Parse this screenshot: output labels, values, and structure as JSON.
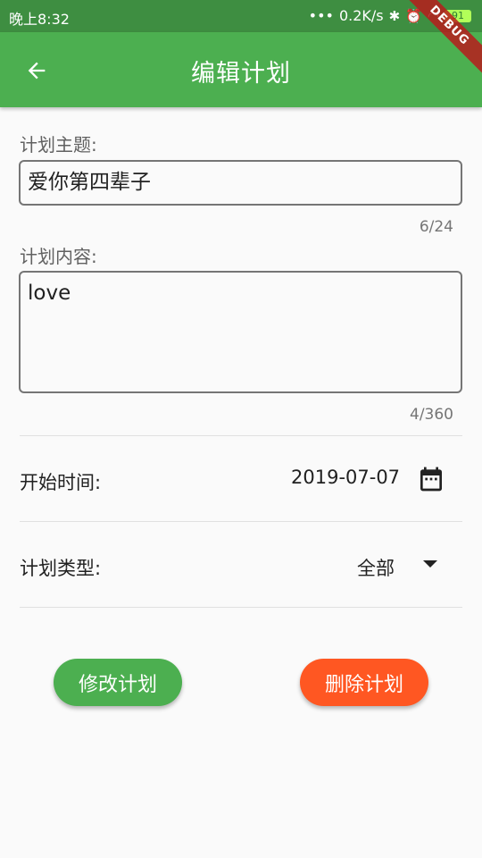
{
  "status_bar": {
    "time": "晚上8:32",
    "dots": "•••",
    "speed": "0.2K/s",
    "battery": "91"
  },
  "app_bar": {
    "title": "编辑计划"
  },
  "debug_banner": "DEBUG",
  "form": {
    "subject": {
      "label": "计划主题:",
      "value": "爱你第四辈子",
      "counter": "6/24"
    },
    "content": {
      "label": "计划内容:",
      "value": "love",
      "counter": "4/360"
    },
    "start_time": {
      "label": "开始时间:",
      "value": "2019-07-07"
    },
    "plan_type": {
      "label": "计划类型:",
      "selected": "全部"
    }
  },
  "buttons": {
    "edit": "修改计划",
    "delete": "删除计划"
  },
  "colors": {
    "primary": "#4CAF50",
    "status_bar": "#3E8E41",
    "delete": "#FF5722"
  }
}
